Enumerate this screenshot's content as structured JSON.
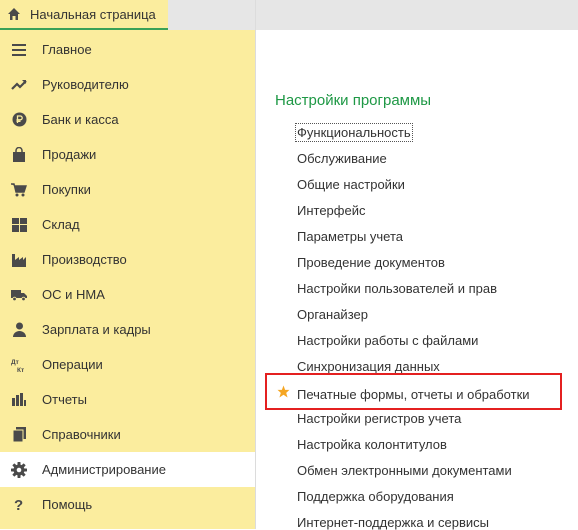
{
  "tab": {
    "label": "Начальная страница"
  },
  "sidebar": {
    "items": [
      {
        "label": "Главное",
        "icon": "menu-icon"
      },
      {
        "label": "Руководителю",
        "icon": "trend-icon"
      },
      {
        "label": "Банк и касса",
        "icon": "ruble-coin-icon"
      },
      {
        "label": "Продажи",
        "icon": "shopping-bag-icon"
      },
      {
        "label": "Покупки",
        "icon": "cart-icon"
      },
      {
        "label": "Склад",
        "icon": "warehouse-grid-icon"
      },
      {
        "label": "Производство",
        "icon": "factory-icon"
      },
      {
        "label": "ОС и НМА",
        "icon": "truck-icon"
      },
      {
        "label": "Зарплата и кадры",
        "icon": "person-icon"
      },
      {
        "label": "Операции",
        "icon": "debit-credit-icon"
      },
      {
        "label": "Отчеты",
        "icon": "bar-chart-icon"
      },
      {
        "label": "Справочники",
        "icon": "books-icon"
      },
      {
        "label": "Администрирование",
        "icon": "gear-icon",
        "active": true
      },
      {
        "label": "Помощь",
        "icon": "question-icon"
      }
    ]
  },
  "main": {
    "section_title": "Настройки программы",
    "links": [
      "Функциональность",
      "Обслуживание",
      "Общие настройки",
      "Интерфейс",
      "Параметры учета",
      "Проведение документов",
      "Настройки пользователей и прав",
      "Органайзер",
      "Настройки работы с файлами",
      "Синхронизация данных",
      "Печатные формы, отчеты и обработки",
      "Настройки регистров учета",
      "Настройка колонтитулов",
      "Обмен электронными документами",
      "Поддержка оборудования",
      "Интернет-поддержка и сервисы"
    ]
  },
  "colors": {
    "sidebar_bg": "#fbed9e",
    "active_item_bg": "#ffffff",
    "section_title": "#1e9845",
    "highlight_border": "#e42020",
    "star": "#f5a623"
  }
}
